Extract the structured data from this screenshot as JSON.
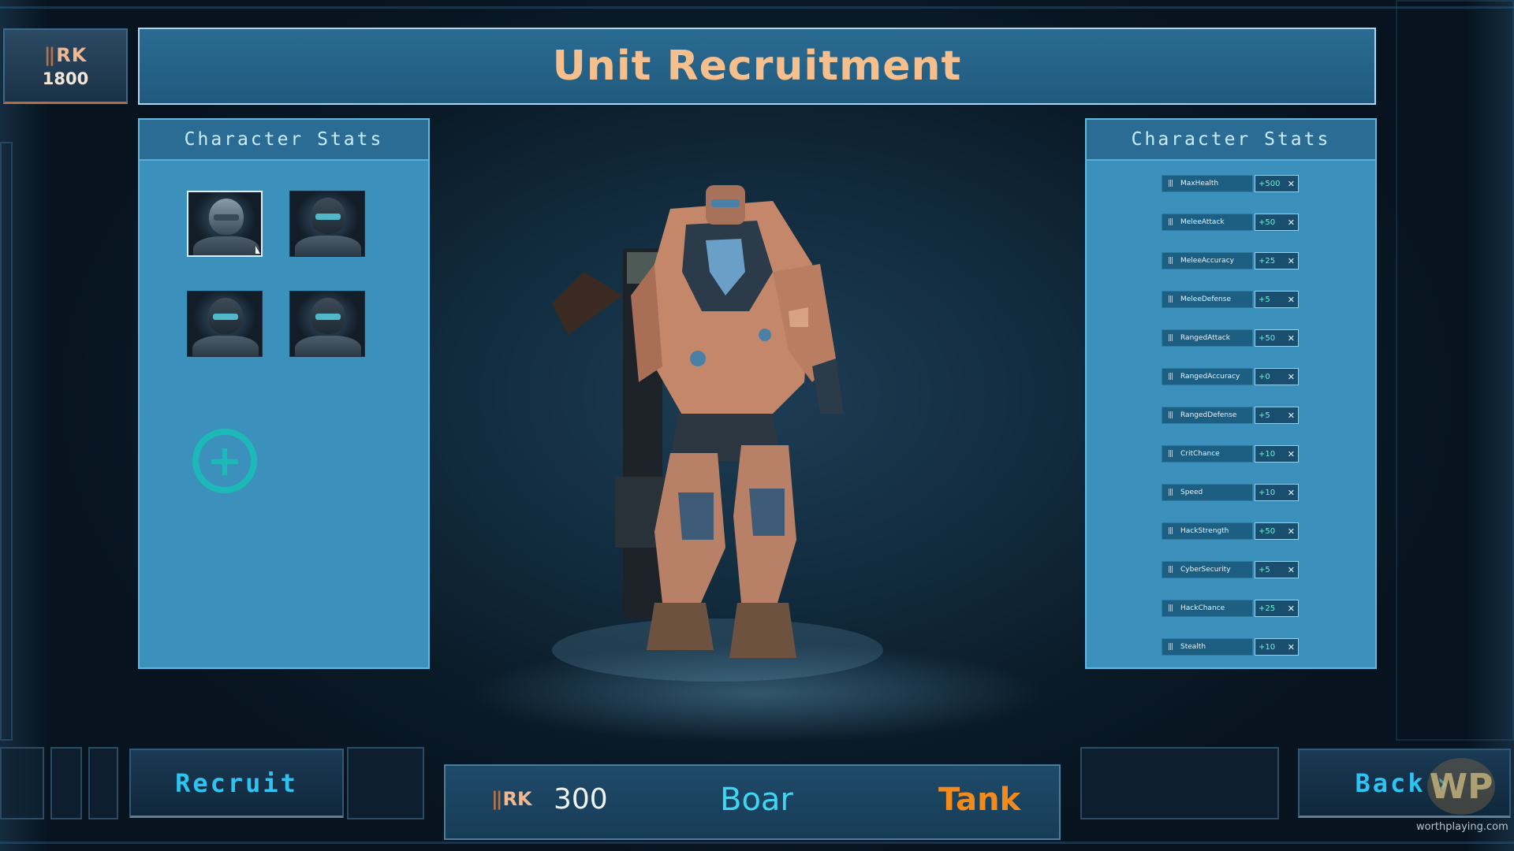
{
  "header": {
    "title": "Unit Recruitment",
    "credits": {
      "logo": "RK",
      "amount": "1800"
    }
  },
  "left_panel": {
    "title": "Character Stats",
    "portraits": [
      {
        "name": "portrait-1",
        "selected": true
      },
      {
        "name": "portrait-2",
        "selected": false
      },
      {
        "name": "portrait-3",
        "selected": false
      },
      {
        "name": "portrait-4",
        "selected": false
      }
    ],
    "add_button": "+"
  },
  "right_panel": {
    "title": "Character Stats",
    "stats": [
      {
        "name": "MaxHealth",
        "value": "+500"
      },
      {
        "name": "MeleeAttack",
        "value": "+50"
      },
      {
        "name": "MeleeAccuracy",
        "value": "+25"
      },
      {
        "name": "MeleeDefense",
        "value": "+5"
      },
      {
        "name": "RangedAttack",
        "value": "+50"
      },
      {
        "name": "RangedAccuracy",
        "value": "+0"
      },
      {
        "name": "RangedDefense",
        "value": "+5"
      },
      {
        "name": "CritChance",
        "value": "+10"
      },
      {
        "name": "Speed",
        "value": "+10"
      },
      {
        "name": "HackStrength",
        "value": "+50"
      },
      {
        "name": "CyberSecurity",
        "value": "+5"
      },
      {
        "name": "HackChance",
        "value": "+25"
      },
      {
        "name": "Stealth",
        "value": "+10"
      }
    ]
  },
  "footer": {
    "recruit_label": "Recruit",
    "back_label": "Back",
    "cost_logo": "RK",
    "cost": "300",
    "unit_name": "Boar",
    "unit_role": "Tank"
  },
  "watermark": "worthplaying.com",
  "colors": {
    "title": "#f5c08e",
    "panel": "#3b91bb",
    "accent": "#2fc3f2",
    "stat_value": "#6ff0d8",
    "role": "#f28b1c",
    "add_icon": "#1db8b8"
  }
}
